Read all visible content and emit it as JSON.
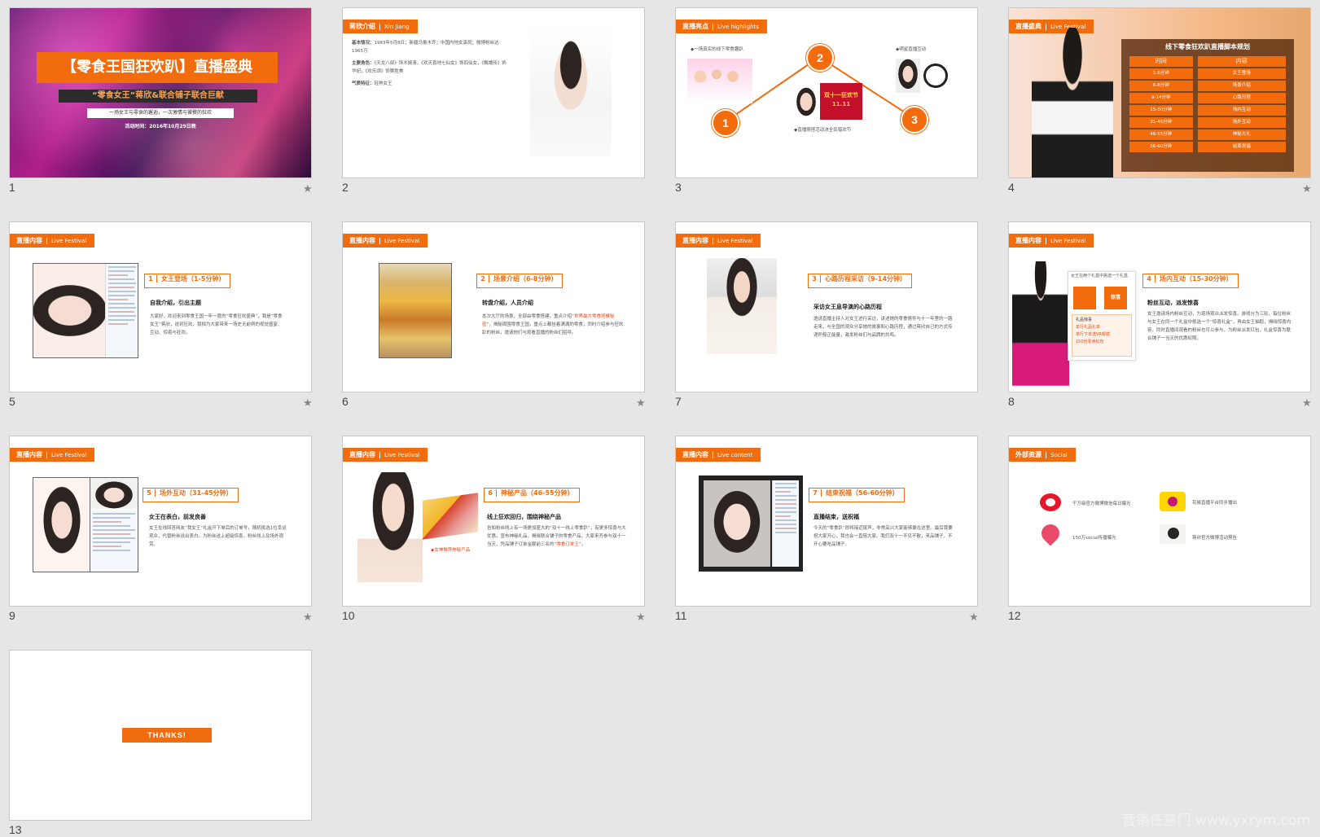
{
  "slides": [
    {
      "num": "1",
      "star": "★",
      "title": "【零食王国狂欢趴】直播盛典",
      "subtitle": "“零食女王”蒋欣&联合铺子联合巨献",
      "tagline": "一场女王与零食的邂逅，一次激情与饕餮的狂欢",
      "date": "活动时间：2016年10月29日晚"
    },
    {
      "num": "2",
      "tag": "蒋欣介绍",
      "tag_en": "Xin Jiang",
      "lines": [
        [
          "基本情况：",
          "1983年5月8日；新疆乌鲁木齐；中国内地女演员；微博粉丝达1965万"
        ],
        [
          "主要角色：",
          "《天龙八部》饰木婉清，《欢天喜地七仙女》饰四仙女，《甄嬛传》饰华妃，《欢乐颂》饰樊胜美"
        ],
        [
          "气质特征：",
          "轻熟女王"
        ]
      ]
    },
    {
      "num": "3",
      "tag": "直播亮点",
      "tag_en": "Live highlights",
      "p1": "◆一场真实的线下零食趣趴",
      "p2": "◆明星直播互动",
      "p3": "◆直播照搭活动决全民猎欢节",
      "c1": "1",
      "c2": "2",
      "c3": "3",
      "banner": "双十一狂欢节 11.11"
    },
    {
      "num": "4",
      "star": "★",
      "tag": "直播盛典",
      "tag_en": "Live Festival",
      "title": "线下零食狂欢趴直播脚本规划",
      "col1": "时间",
      "col2": "内容",
      "rows": [
        [
          "1-5分钟",
          "女王登场"
        ],
        [
          "6-8分钟",
          "场景介绍"
        ],
        [
          "9-14分钟",
          "心路历程"
        ],
        [
          "15-30分钟",
          "场内互动"
        ],
        [
          "31-45分钟",
          "场外互动"
        ],
        [
          "46-55分钟",
          "神秘大礼"
        ],
        [
          "56-60分钟",
          "结束祝福"
        ]
      ]
    },
    {
      "num": "5",
      "star": "★",
      "tag": "直播内容",
      "tag_en": "Live Festival",
      "step_n": "1",
      "step": "女王登场（1-5分钟）",
      "sub": "自我介绍，引出主题",
      "para": "大家好，欢迎来到零食王国一年一度的“零食狂欢盛典”，我是“零食女王”蒋欣，说到狂欢，我相为大家带来一场史无前例的视觉盛宴、互动、惊喜与狂欢。"
    },
    {
      "num": "6",
      "star": "★",
      "tag": "直播内容",
      "tag_en": "Live Festival",
      "step_n": "2",
      "step": "场景介绍（6-8分钟）",
      "sub": "转盘介绍，人员介绍",
      "para_a": "本次大厅的场景，全部由零食搭建，重点介绍“",
      "para_hl": "世界最大零食塔楼秘密",
      "para_b": "”，揭秘周围零食王国，重点上都挂着满满的零食，同时介绍参与狂欢趴的粉丝，邀请他们与观看直播的粉丝们招呼。"
    },
    {
      "num": "7",
      "tag": "直播内容",
      "tag_en": "Live Festival",
      "step_n": "3",
      "step": "心路历程采访（9-14分钟）",
      "sub": "采访女王息导演的心路历程",
      "para": "邀请直播主持人对女王进行采访，讲述她的零食情怀与十一年里的一路走来，与全国的观众分享她的故事和心路历程，通过蒋欣自己的方式传递积极正能量，激发粉丝们与品牌的共鸣。"
    },
    {
      "num": "8",
      "star": "★",
      "tag": "直播内容",
      "tag_en": "Live Festival",
      "step_n": "4",
      "step": "场内互动（15-30分钟）",
      "sub": "粉丝互动，派发惊喜",
      "para": "女王邀请场内粉丝互动，为现场观众派发惊喜。游戏分为三轮，每位粉丝与女王在同一个礼盒中挑选一个“惊喜礼盒”，再由女王抽取，揭晓惊喜内容，同时直播间观看的粉丝也可以参与，为粉丝派发红包，礼盒惊喜为联合铺子一当天的优惠权限。",
      "gift_title": "女王在两个礼盒中挑选一个礼盒",
      "gift_lines": [
        "礼品惊喜",
        "单行礼品礼单",
        "单行下单送VR眼镜",
        "150份零食红包"
      ],
      "box_label": "惊喜"
    },
    {
      "num": "9",
      "star": "★",
      "tag": "直播内容",
      "tag_en": "Live Festival",
      "step_n": "5",
      "step": "场外互动（31-45分钟）",
      "sub": "女王在表白，前发良善",
      "para": "女王在线回答网友“我女王”礼盒开下单后的订单号，随机挑选1位幸运观众，代替粉丝说出表白，为粉丝送上超级惊喜，粉丝线上及场外观赏。"
    },
    {
      "num": "10",
      "star": "★",
      "tag": "直播内容",
      "tag_en": "Live Festival",
      "step_n": "6",
      "step": "神秘产品（46-55分钟）",
      "sub": "线上狂欢回归，围绕神秘产品",
      "para_a": "告知粉丝线上有一场更加盛大的“双十一线上零食趴”，有更多惊喜与大优惠。宣布神秘礼品，揭晓联合铺子的零食产品，大家来齐参与双十一当天，凭品铺子订单金额前三名的“",
      "para_hl": "零食订单王",
      "para_b": "”。",
      "caption": "◆女神推荐神秘产品"
    },
    {
      "num": "11",
      "star": "★",
      "tag": "直播内容",
      "tag_en": "Live content",
      "step_n": "7",
      "step": "结束祝福（56-60分钟）",
      "sub": "直播结束，送祝福",
      "para": "今天的“零食趴”即将接近尾声，非常高兴大家能够聚在这里。最后我要祝大家开心，我也会一直陪大家。我们双十一不见不散，来品铺子，不开心要吃品铺子。"
    },
    {
      "num": "12",
      "tag": "外部资源",
      "tag_en": "Social",
      "r1": "千万级官方微博微信每日曝光",
      "r2": "花椒直播平台同步播出",
      "r3": "150万social传播曝光",
      "r4": "蒋欣官方微博活动预告"
    },
    {
      "num": "13",
      "button": "THANKS!"
    }
  ],
  "watermark": "营销任意门 www.yxrym.com",
  "colors": {
    "accent": "#f26c0d",
    "bg": "#e6e6e6"
  }
}
